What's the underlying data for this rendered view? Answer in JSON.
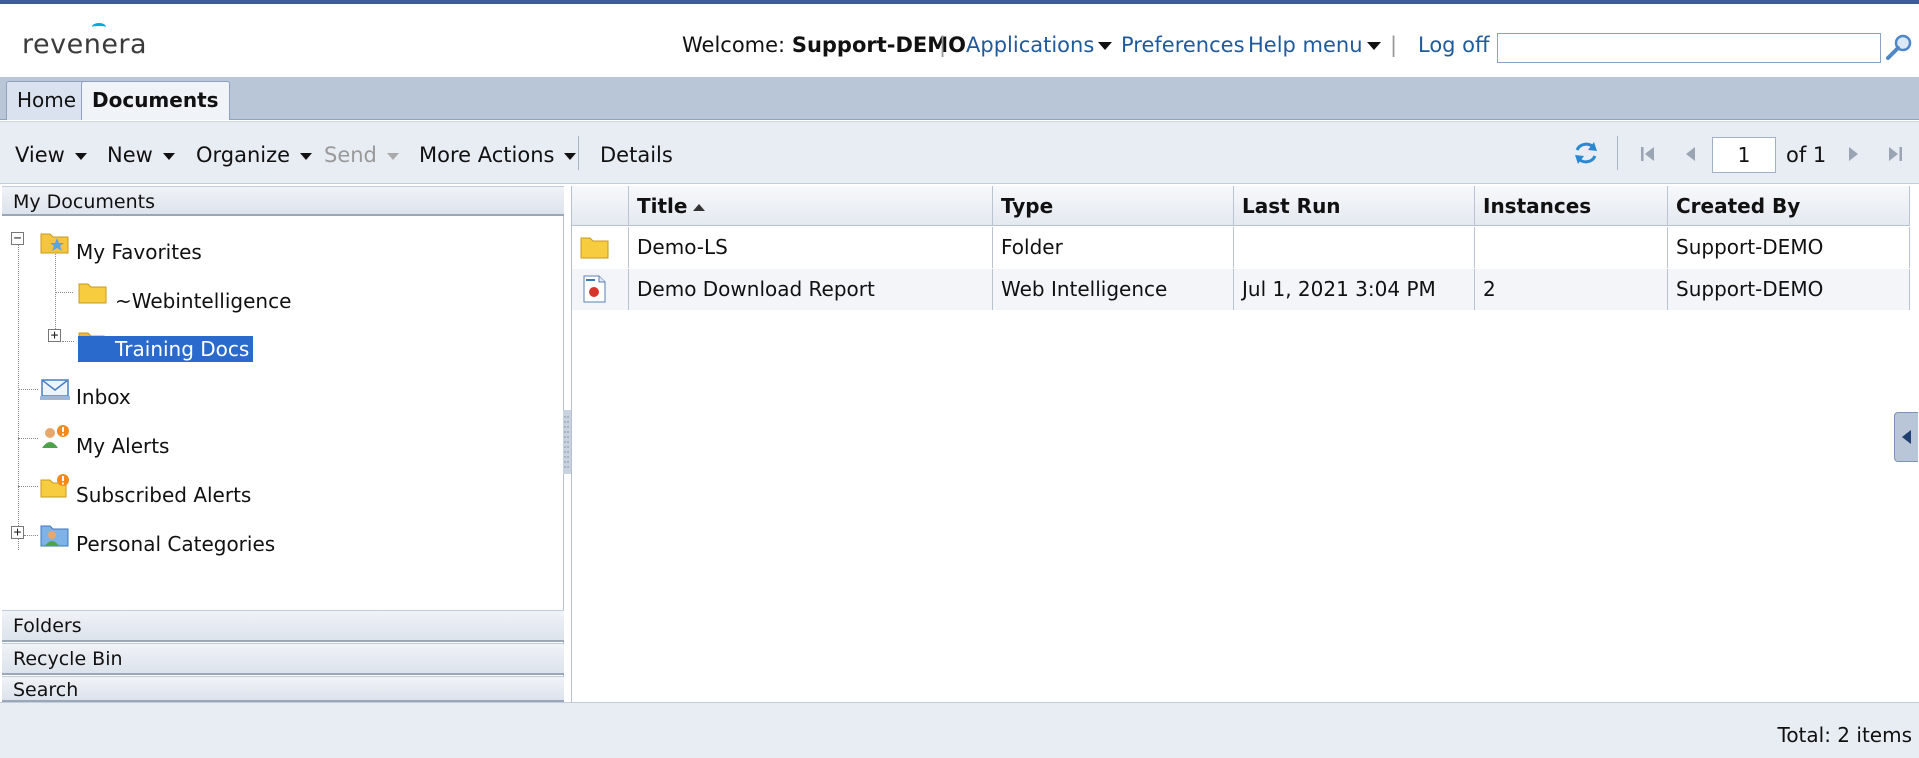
{
  "header": {
    "logo": "revenera",
    "welcome_label": "Welcome:",
    "username": "Support-DEMO",
    "applications": "Applications",
    "preferences": "Preferences",
    "help_menu": "Help menu",
    "log_off": "Log off",
    "search_placeholder": ""
  },
  "tabs": [
    {
      "label": "Home"
    },
    {
      "label": "Documents",
      "active": true
    }
  ],
  "toolbar": {
    "view": "View",
    "new": "New",
    "organize": "Organize",
    "send": "Send",
    "more_actions": "More Actions",
    "details": "Details",
    "page_value": "1",
    "page_of": "of 1"
  },
  "left_panel": {
    "my_documents": "My Documents",
    "tree": {
      "my_favorites": "My Favorites",
      "webintelligence": "~Webintelligence",
      "training_docs": "Training Docs",
      "inbox": "Inbox",
      "my_alerts": "My Alerts",
      "subscribed_alerts": "Subscribed Alerts",
      "personal_categories": "Personal Categories"
    },
    "folders": "Folders",
    "recycle_bin": "Recycle Bin",
    "search": "Search"
  },
  "table": {
    "columns": [
      "Title",
      "Type",
      "Last Run",
      "Instances",
      "Created By"
    ],
    "rows": [
      {
        "title": "Demo-LS",
        "type": "Folder",
        "last_run": "",
        "instances": "",
        "created_by": "Support-DEMO",
        "icon": "folder-icon"
      },
      {
        "title": "Demo Download Report",
        "type": "Web Intelligence",
        "last_run": "Jul 1, 2021 3:04 PM",
        "instances": "2",
        "created_by": "Support-DEMO",
        "icon": "webi-report-icon"
      }
    ]
  },
  "footer": {
    "total": "Total: 2 items"
  },
  "colors": {
    "link": "#1f5a9c",
    "selection": "#2a6acc",
    "tabbar": "#b8c6d8",
    "toolbar": "#e8edf4"
  }
}
